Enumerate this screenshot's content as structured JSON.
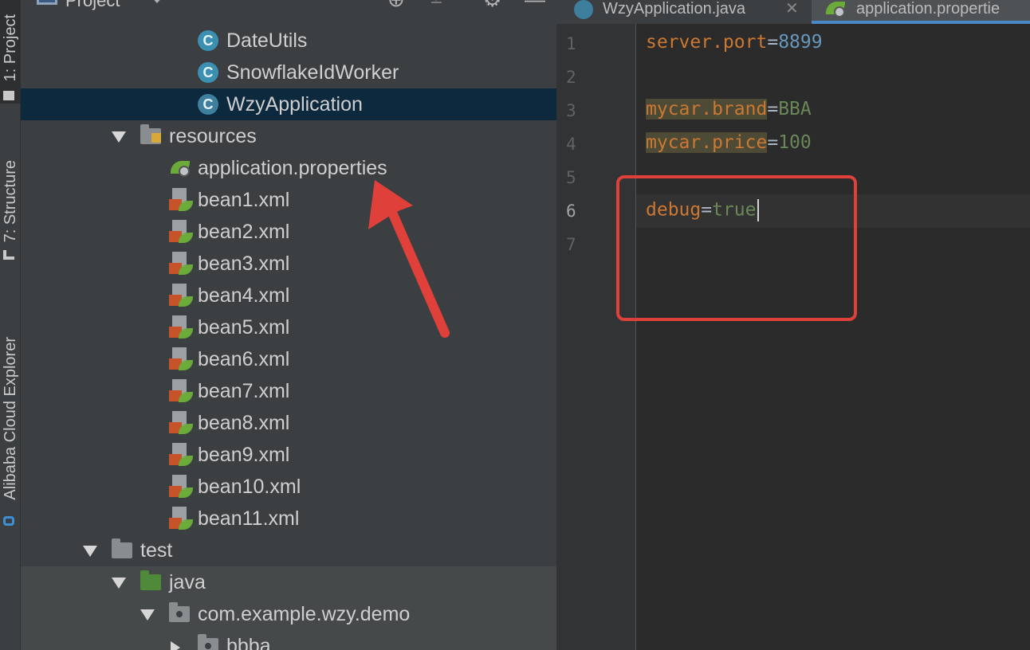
{
  "tool_strip": {
    "project_tab": "1: Project",
    "structure_tab": "7: Structure",
    "cloud_tab": "Alibaba Cloud Explorer"
  },
  "project_panel": {
    "title": "Project",
    "icons": [
      "locate-icon",
      "collapse-icon",
      "gear-icon",
      "minimize-icon"
    ],
    "tree": [
      {
        "label": "DateUtils",
        "type": "class",
        "depth": 3
      },
      {
        "label": "SnowflakeIdWorker",
        "type": "class",
        "depth": 3
      },
      {
        "label": "WzyApplication",
        "type": "spring-class",
        "depth": 3,
        "selected": true
      },
      {
        "label": "resources",
        "type": "resources-folder",
        "depth": 2,
        "expanded": true
      },
      {
        "label": "application.properties",
        "type": "properties",
        "depth": 3
      },
      {
        "label": "bean1.xml",
        "type": "xml",
        "depth": 3
      },
      {
        "label": "bean2.xml",
        "type": "xml",
        "depth": 3
      },
      {
        "label": "bean3.xml",
        "type": "xml",
        "depth": 3
      },
      {
        "label": "bean4.xml",
        "type": "xml",
        "depth": 3
      },
      {
        "label": "bean5.xml",
        "type": "xml",
        "depth": 3
      },
      {
        "label": "bean6.xml",
        "type": "xml",
        "depth": 3
      },
      {
        "label": "bean7.xml",
        "type": "xml",
        "depth": 3
      },
      {
        "label": "bean8.xml",
        "type": "xml",
        "depth": 3
      },
      {
        "label": "bean9.xml",
        "type": "xml",
        "depth": 3
      },
      {
        "label": "bean10.xml",
        "type": "xml",
        "depth": 3
      },
      {
        "label": "bean11.xml",
        "type": "xml",
        "depth": 3
      },
      {
        "label": "test",
        "type": "folder",
        "depth": 1,
        "expanded": true
      },
      {
        "label": "java",
        "type": "test-folder",
        "depth": 2,
        "expanded": true
      },
      {
        "label": "com.example.wzy.demo",
        "type": "package",
        "depth": 3,
        "expanded": true
      },
      {
        "label": "bbba",
        "type": "package",
        "depth": 4,
        "expanded": false
      }
    ]
  },
  "editor": {
    "tabs": [
      {
        "label": "WzyApplication.java",
        "active": false
      },
      {
        "label": "application.propertie",
        "active": true
      }
    ],
    "line_numbers": [
      "1",
      "2",
      "3",
      "4",
      "5",
      "6",
      "7"
    ],
    "lines": [
      {
        "key": "server.port",
        "eq": "=",
        "value": "8899",
        "value_kind": "number"
      },
      {
        "key": "",
        "eq": "",
        "value": "",
        "value_kind": ""
      },
      {
        "key": "mycar.brand",
        "eq": "=",
        "value": "BBA",
        "value_kind": "string"
      },
      {
        "key": "mycar.price",
        "eq": "=",
        "value": "100",
        "value_kind": "string"
      },
      {
        "key": "",
        "eq": "",
        "value": "",
        "value_kind": ""
      },
      {
        "key": "debug",
        "eq": "=",
        "value": "true",
        "value_kind": "string"
      },
      {
        "key": "",
        "eq": "",
        "value": "",
        "value_kind": ""
      }
    ],
    "current_line": 6
  },
  "annotations": {
    "color": "#e0403a"
  },
  "colors": {
    "panel_bg": "#3c3f41",
    "editor_bg": "#2b2b2b",
    "selection": "#0d293e",
    "key": "#cc7832",
    "number": "#6897bb",
    "string": "#6a8759"
  }
}
